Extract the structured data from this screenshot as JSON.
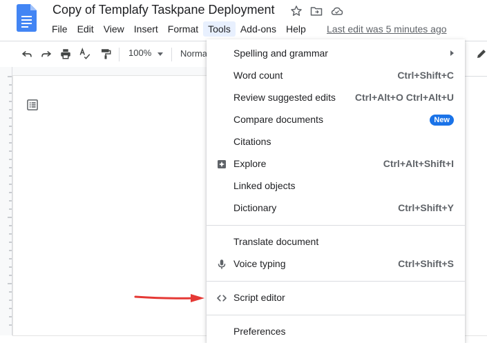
{
  "header": {
    "title": "Copy of Templafy Taskpane Deployment",
    "last_edit": "Last edit was 5 minutes ago",
    "icons": [
      "docs-logo-icon",
      "star-icon",
      "move-to-folder-icon",
      "cloud-status-icon"
    ]
  },
  "menubar": {
    "items": [
      "File",
      "Edit",
      "View",
      "Insert",
      "Format",
      "Tools",
      "Add-ons",
      "Help"
    ],
    "active": "Tools"
  },
  "toolbar": {
    "zoom": "100%",
    "style": "Normal",
    "icons": [
      "undo-icon",
      "redo-icon",
      "print-icon",
      "spellcheck-icon",
      "paint-format-icon",
      "zoom-dropdown-icon",
      "pencil-edit-icon"
    ]
  },
  "tools_menu": {
    "items": [
      {
        "label": "Spelling and grammar",
        "shortcut": "",
        "submenu": true
      },
      {
        "label": "Word count",
        "shortcut": "Ctrl+Shift+C"
      },
      {
        "label": "Review suggested edits",
        "shortcut": "Ctrl+Alt+O Ctrl+Alt+U"
      },
      {
        "label": "Compare documents",
        "badge": "New"
      },
      {
        "label": "Citations",
        "shortcut": ""
      },
      {
        "label": "Explore",
        "shortcut": "Ctrl+Alt+Shift+I",
        "icon": "explore-icon"
      },
      {
        "label": "Linked objects",
        "shortcut": ""
      },
      {
        "label": "Dictionary",
        "shortcut": "Ctrl+Shift+Y"
      },
      {
        "label": "Translate document",
        "shortcut": ""
      },
      {
        "label": "Voice typing",
        "shortcut": "Ctrl+Shift+S",
        "icon": "microphone-icon"
      },
      {
        "label": "Script editor",
        "shortcut": "",
        "icon": "code-brackets-icon"
      },
      {
        "label": "Preferences",
        "shortcut": ""
      }
    ]
  },
  "colors": {
    "accent": "#1a73e8",
    "annotation_arrow": "#e53935",
    "menu_active_bg": "#e8f0fe"
  }
}
